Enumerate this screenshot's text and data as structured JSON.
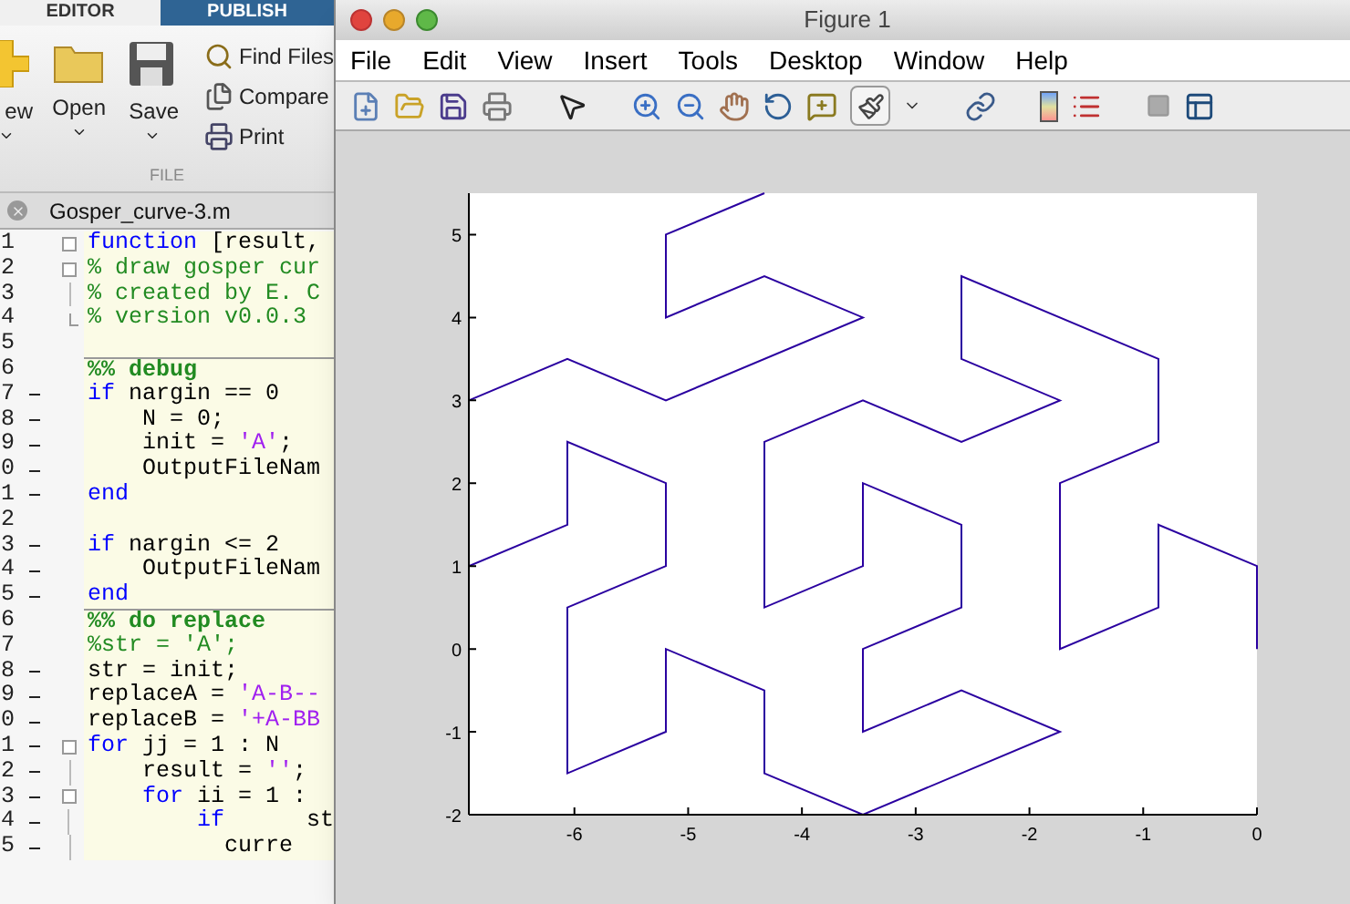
{
  "editor": {
    "tabs": [
      {
        "label": "EDITOR",
        "selected": true
      },
      {
        "label": "PUBLISH",
        "selected": false
      }
    ],
    "file_buttons": [
      {
        "kind": "new",
        "label": "ew"
      },
      {
        "kind": "open",
        "label": "Open"
      },
      {
        "kind": "save",
        "label": "Save"
      }
    ],
    "side_buttons": [
      {
        "kind": "find",
        "label": "Find Files"
      },
      {
        "kind": "compare",
        "label": "Compare"
      },
      {
        "kind": "print",
        "label": "Print"
      }
    ],
    "section_label": "FILE",
    "file_tab": "Gosper_curve-3.m",
    "lines": [
      {
        "number": "1",
        "dash": false,
        "kind": "fold",
        "cell_start": false,
        "tokens": [
          {
            "kind": "keyword",
            "text": "function"
          },
          {
            "kind": "plain",
            "text": " [result,"
          }
        ]
      },
      {
        "number": "2",
        "dash": false,
        "kind": "fold",
        "cell_start": false,
        "tokens": [
          {
            "kind": "comment",
            "text": "% draw gosper cur"
          }
        ]
      },
      {
        "number": "3",
        "dash": false,
        "kind": "inner",
        "cell_start": false,
        "tokens": [
          {
            "kind": "comment",
            "text": "% created by E. C"
          }
        ]
      },
      {
        "number": "4",
        "dash": false,
        "kind": "end",
        "cell_start": false,
        "tokens": [
          {
            "kind": "comment",
            "text": "% version v0.0.3"
          }
        ]
      },
      {
        "number": "5",
        "dash": false,
        "kind": "plain",
        "cell_start": false
      },
      {
        "number": "6",
        "dash": false,
        "kind": "plain",
        "cell_start": true,
        "tokens": [
          {
            "kind": "cell",
            "text": "%% debug"
          }
        ]
      },
      {
        "number": "7",
        "dash": true,
        "kind": "plain",
        "cell_start": false,
        "tokens": [
          {
            "kind": "keyword",
            "text": "if"
          },
          {
            "kind": "plain",
            "text": " nargin == 0"
          }
        ]
      },
      {
        "number": "8",
        "dash": true,
        "kind": "plain",
        "cell_start": false,
        "tokens": [
          {
            "kind": "plain",
            "text": "    N = 0;"
          }
        ]
      },
      {
        "number": "9",
        "dash": true,
        "kind": "plain",
        "cell_start": false,
        "tokens": [
          {
            "kind": "plain",
            "text": "    init = "
          },
          {
            "kind": "string",
            "text": "'A'"
          },
          {
            "kind": "plain",
            "text": ";"
          }
        ]
      },
      {
        "number": "0",
        "dash": true,
        "kind": "plain",
        "cell_start": false,
        "tokens": [
          {
            "kind": "plain",
            "text": "    OutputFileNam"
          }
        ]
      },
      {
        "number": "1",
        "dash": true,
        "kind": "plain",
        "cell_start": false,
        "tokens": [
          {
            "kind": "keyword",
            "text": "end"
          }
        ]
      },
      {
        "number": "2",
        "dash": false,
        "kind": "plain",
        "cell_start": false
      },
      {
        "number": "3",
        "dash": true,
        "kind": "plain",
        "cell_start": false,
        "tokens": [
          {
            "kind": "keyword",
            "text": "if"
          },
          {
            "kind": "plain",
            "text": " nargin <= 2"
          }
        ]
      },
      {
        "number": "4",
        "dash": true,
        "kind": "plain",
        "cell_start": false,
        "tokens": [
          {
            "kind": "plain",
            "text": "    OutputFileNam"
          }
        ]
      },
      {
        "number": "5",
        "dash": true,
        "kind": "plain",
        "cell_start": false,
        "tokens": [
          {
            "kind": "keyword",
            "text": "end"
          }
        ]
      },
      {
        "number": "6",
        "dash": false,
        "kind": "plain",
        "cell_start": true,
        "tokens": [
          {
            "kind": "cell",
            "text": "%% do replace"
          }
        ]
      },
      {
        "number": "7",
        "dash": false,
        "kind": "plain",
        "cell_start": false,
        "tokens": [
          {
            "kind": "comment",
            "text": "%str = 'A';"
          }
        ]
      },
      {
        "number": "8",
        "dash": true,
        "kind": "plain",
        "cell_start": false,
        "tokens": [
          {
            "kind": "plain",
            "text": "str = init;"
          }
        ]
      },
      {
        "number": "9",
        "dash": true,
        "kind": "plain",
        "cell_start": false,
        "tokens": [
          {
            "kind": "plain",
            "text": "replaceA = "
          },
          {
            "kind": "string",
            "text": "'A-B--"
          }
        ]
      },
      {
        "number": "0",
        "dash": true,
        "kind": "plain",
        "cell_start": false,
        "tokens": [
          {
            "kind": "plain",
            "text": "replaceB = "
          },
          {
            "kind": "string",
            "text": "'+A-BB"
          }
        ]
      },
      {
        "number": "1",
        "dash": true,
        "kind": "fold",
        "cell_start": false,
        "tokens": [
          {
            "kind": "keyword",
            "text": "for"
          },
          {
            "kind": "plain",
            "text": " jj = 1 : N"
          }
        ]
      },
      {
        "number": "2",
        "dash": true,
        "kind": "inner",
        "cell_start": false,
        "tokens": [
          {
            "kind": "plain",
            "text": "    result = "
          },
          {
            "kind": "string",
            "text": "''"
          },
          {
            "kind": "plain",
            "text": ";"
          }
        ]
      },
      {
        "number": "3",
        "dash": true,
        "kind": "fold",
        "cell_start": false,
        "tokens": [
          {
            "kind": "keyword",
            "text": "    for"
          },
          {
            "kind": "plain",
            "text": " ii = 1 :"
          }
        ]
      },
      {
        "number": "4",
        "dash": true,
        "kind": "inner",
        "cell_start": false,
        "tokens": [
          {
            "kind": "keyword",
            "text": "        if"
          },
          {
            "kind": "plain",
            "text": "      st"
          }
        ]
      },
      {
        "number": "5",
        "dash": true,
        "kind": "inner",
        "cell_start": false,
        "tokens": [
          {
            "kind": "plain",
            "text": "          curre"
          }
        ]
      }
    ]
  },
  "figure": {
    "title": "Figure 1",
    "menu": [
      "File",
      "Edit",
      "View",
      "Insert",
      "Tools",
      "Desktop",
      "Window",
      "Help"
    ],
    "tools": [
      {
        "kind": "new"
      },
      {
        "kind": "open"
      },
      {
        "kind": "save"
      },
      {
        "kind": "print"
      },
      {
        "kind": "gap"
      },
      {
        "kind": "pointer"
      },
      {
        "kind": "gap"
      },
      {
        "kind": "zoom-in"
      },
      {
        "kind": "zoom-out"
      },
      {
        "kind": "pan"
      },
      {
        "kind": "rotate"
      },
      {
        "kind": "datacursor"
      },
      {
        "kind": "brush"
      },
      {
        "kind": "caret"
      },
      {
        "kind": "gap"
      },
      {
        "kind": "link"
      },
      {
        "kind": "gap"
      },
      {
        "kind": "colorbar"
      },
      {
        "kind": "legend"
      },
      {
        "kind": "gap"
      },
      {
        "kind": "square"
      },
      {
        "kind": "layout"
      }
    ],
    "chart_data": {
      "type": "line",
      "xlim": [
        -6.928,
        0
      ],
      "ylim": [
        -2,
        5.5
      ],
      "xticks": [
        -6,
        -5,
        -4,
        -3,
        -2,
        -1,
        0
      ],
      "yticks": [
        -2,
        -1,
        0,
        1,
        2,
        3,
        4,
        5
      ],
      "series": [
        {
          "color": "#2a00a0",
          "x": [
            0,
            0,
            -0.866,
            -0.866,
            -1.732,
            -1.732,
            -0.866,
            -0.866,
            -2.598,
            -2.598,
            -1.732,
            -2.598,
            -3.464,
            -4.33,
            -4.33,
            -3.464,
            -3.464,
            -2.598,
            -2.598,
            -3.464,
            -3.464,
            -2.598,
            -1.732,
            -3.464,
            -4.33,
            -4.33,
            -5.196,
            -5.196,
            -6.062,
            -6.062,
            -5.196,
            -5.196,
            -6.062,
            -6.062,
            -6.928,
            -6.928,
            -6.062,
            -5.196,
            -3.464,
            -4.33,
            -5.196,
            -5.196,
            -4.33
          ],
          "values": [
            0,
            1,
            1.5,
            0.5,
            0,
            2,
            2.5,
            3.5,
            4.5,
            3.5,
            3,
            2.5,
            3,
            2.5,
            0.5,
            1,
            2,
            1.5,
            0.5,
            0,
            -1,
            -0.5,
            -1,
            -2,
            -1.5,
            -0.5,
            0,
            -1,
            -1.5,
            0.5,
            1,
            2,
            2.5,
            1.5,
            1,
            3,
            3.5,
            3,
            4,
            4.5,
            4,
            5,
            5.5
          ]
        }
      ]
    }
  }
}
